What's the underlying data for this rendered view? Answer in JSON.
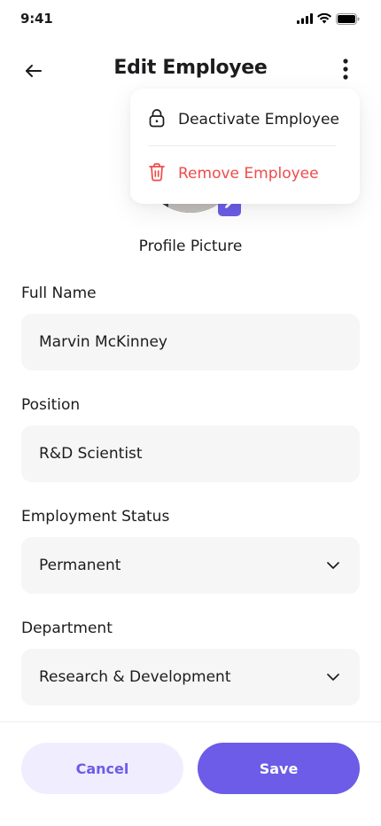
{
  "status_bar": {
    "time": "9:41",
    "icons": [
      "signal-icon",
      "wifi-icon",
      "battery-icon"
    ]
  },
  "header": {
    "title": "Edit Employee",
    "back_icon": "arrow-left-icon",
    "more_icon": "more-vertical-icon"
  },
  "menu": {
    "items": [
      {
        "label": "Deactivate Employee",
        "icon": "lock-icon",
        "color": "#1c1c1e"
      },
      {
        "label": "Remove Employee",
        "icon": "trash-icon",
        "color": "#ef4b4b"
      }
    ]
  },
  "profile": {
    "label": "Profile Picture",
    "edit_icon": "pencil-icon"
  },
  "form": {
    "full_name": {
      "label": "Full Name",
      "value": "Marvin McKinney"
    },
    "position": {
      "label": "Position",
      "value": "R&D Scientist"
    },
    "employment_status": {
      "label": "Employment Status",
      "value": "Permanent"
    },
    "department": {
      "label": "Department",
      "value": "Research & Development"
    }
  },
  "actions": {
    "cancel_label": "Cancel",
    "save_label": "Save"
  },
  "colors": {
    "accent": "#6c5ce7",
    "accent_light": "#f0eefe",
    "danger": "#ef4b4b",
    "field_bg": "#f6f6f6"
  }
}
